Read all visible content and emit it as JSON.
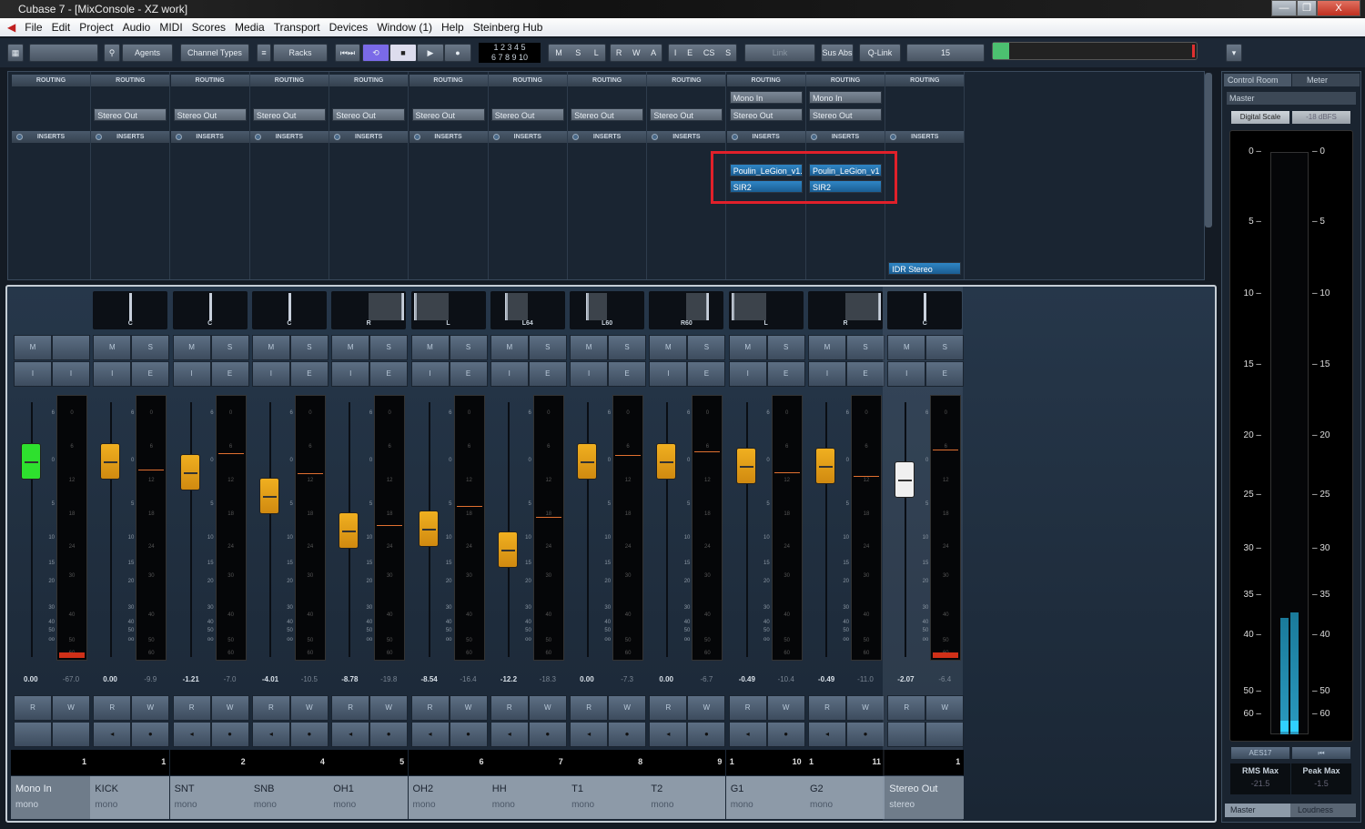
{
  "window": {
    "title": "Cubase 7 - [MixConsole - XZ work]",
    "min": "—",
    "max": "❐",
    "close": "X"
  },
  "menu": [
    "File",
    "Edit",
    "Project",
    "Audio",
    "MIDI",
    "Scores",
    "Media",
    "Transport",
    "Devices",
    "Window (1)",
    "Help",
    "Steinberg Hub"
  ],
  "toolbar": {
    "agents": "Agents",
    "channel_types": "Channel Types",
    "racks": "Racks",
    "numbers_top": "1 2 3 4 5",
    "numbers_bottom": "6 7 8 9 10",
    "m": "M",
    "s": "S",
    "l": "L",
    "r": "R",
    "w": "W",
    "a": "A",
    "i": "I",
    "e": "E",
    "cs": "CS",
    "s2": "S",
    "link": "Link",
    "sus_abs": "Sus Abs",
    "qlink": "Q-Link",
    "zoom_value": "15",
    "level": 0.08
  },
  "rack": {
    "routing_label": "ROUTING",
    "inserts_label": "INSERTS"
  },
  "channels": [
    {
      "name": "Mono In",
      "type": "mono",
      "pan": "",
      "num": "1",
      "prefix": "",
      "fader": "0.00",
      "peak": "-67.0",
      "db": 0,
      "pk": -67,
      "input": "",
      "output": "",
      "inserts": [],
      "ms": [
        "M",
        ""
      ],
      "ie": [
        "I",
        "I"
      ],
      "row2": [
        "",
        ""
      ],
      "color": "#2ee02e",
      "clip": true,
      "first": true
    },
    {
      "name": "KICK",
      "type": "mono",
      "pan": "C",
      "num": "1",
      "prefix": "",
      "fader": "0.00",
      "peak": "-9.9",
      "db": 0,
      "pk": -9.9,
      "input": "",
      "output": "Stereo Out",
      "inserts": [],
      "ms": [
        "M",
        "S"
      ],
      "ie": [
        "I",
        "E"
      ],
      "row2": [
        "◂",
        "●"
      ]
    },
    {
      "name": "SNT",
      "type": "mono",
      "pan": "C",
      "num": "2",
      "prefix": "",
      "fader": "-1.21",
      "peak": "-7.0",
      "db": -1.21,
      "pk": -7,
      "input": "",
      "output": "Stereo Out",
      "inserts": [],
      "ms": [
        "M",
        "S"
      ],
      "ie": [
        "I",
        "E"
      ],
      "row2": [
        "◂",
        "●"
      ]
    },
    {
      "name": "SNB",
      "type": "mono",
      "pan": "C",
      "num": "4",
      "prefix": "",
      "fader": "-4.01",
      "peak": "-10.5",
      "db": -4.01,
      "pk": -10.5,
      "input": "",
      "output": "Stereo Out",
      "inserts": [],
      "ms": [
        "M",
        "S"
      ],
      "ie": [
        "I",
        "E"
      ],
      "row2": [
        "◂",
        "●"
      ]
    },
    {
      "name": "OH1",
      "type": "mono",
      "pan": "R",
      "num": "5",
      "prefix": "",
      "fader": "-8.78",
      "peak": "-19.8",
      "db": -8.78,
      "pk": -19.8,
      "input": "",
      "output": "Stereo Out",
      "inserts": [],
      "ms": [
        "M",
        "S"
      ],
      "ie": [
        "I",
        "E"
      ],
      "row2": [
        "◂",
        "●"
      ]
    },
    {
      "name": "OH2",
      "type": "mono",
      "pan": "L",
      "num": "6",
      "prefix": "",
      "fader": "-8.54",
      "peak": "-16.4",
      "db": -8.54,
      "pk": -16.4,
      "input": "",
      "output": "Stereo Out",
      "inserts": [],
      "ms": [
        "M",
        "S"
      ],
      "ie": [
        "I",
        "E"
      ],
      "row2": [
        "◂",
        "●"
      ]
    },
    {
      "name": "HH",
      "type": "mono",
      "pan": "L64",
      "num": "7",
      "prefix": "",
      "fader": "-12.2",
      "peak": "-18.3",
      "db": -12.2,
      "pk": -18.3,
      "input": "",
      "output": "Stereo Out",
      "inserts": [],
      "ms": [
        "M",
        "S"
      ],
      "ie": [
        "I",
        "E"
      ],
      "row2": [
        "◂",
        "●"
      ]
    },
    {
      "name": "T1",
      "type": "mono",
      "pan": "L60",
      "num": "8",
      "prefix": "",
      "fader": "0.00",
      "peak": "-7.3",
      "db": 0,
      "pk": -7.3,
      "input": "",
      "output": "Stereo Out",
      "inserts": [],
      "ms": [
        "M",
        "S"
      ],
      "ie": [
        "I",
        "E"
      ],
      "row2": [
        "◂",
        "●"
      ]
    },
    {
      "name": "T2",
      "type": "mono",
      "pan": "R60",
      "num": "9",
      "prefix": "",
      "fader": "0.00",
      "peak": "-6.7",
      "db": 0,
      "pk": -6.7,
      "input": "",
      "output": "Stereo Out",
      "inserts": [],
      "ms": [
        "M",
        "S"
      ],
      "ie": [
        "I",
        "E"
      ],
      "row2": [
        "◂",
        "●"
      ]
    },
    {
      "name": "G1",
      "type": "mono",
      "pan": "L",
      "num": "10",
      "prefix": "1",
      "fader": "-0.49",
      "peak": "-10.4",
      "db": -0.49,
      "pk": -10.4,
      "input": "Mono In",
      "output": "Stereo Out",
      "inserts": [
        "Poulin_LeGion_v1.",
        "SIR2"
      ],
      "ms": [
        "M",
        "S"
      ],
      "ie": [
        "I",
        "E"
      ],
      "row2": [
        "◂",
        "●"
      ]
    },
    {
      "name": "G2",
      "type": "mono",
      "pan": "R",
      "num": "11",
      "prefix": "1",
      "fader": "-0.49",
      "peak": "-11.0",
      "db": -0.49,
      "pk": -11,
      "input": "Mono In",
      "output": "Stereo Out",
      "inserts": [
        "Poulin_LeGion_v1",
        "SIR2"
      ],
      "ms": [
        "M",
        "S"
      ],
      "ie": [
        "I",
        "E"
      ],
      "row2": [
        "◂",
        "●"
      ]
    },
    {
      "name": "Stereo Out",
      "type": "stereo",
      "pan": "C",
      "num": "1",
      "prefix": "",
      "fader": "-2.07",
      "peak": "-6.4",
      "db": -2.07,
      "pk": -6.4,
      "input": "",
      "output": "",
      "inserts": [],
      "bottom_insert": "IDR Stereo",
      "ms": [
        "M",
        "S"
      ],
      "ie": [
        "I",
        "E"
      ],
      "row2": [
        "",
        ""
      ],
      "color": "#f0f0f0",
      "clip": true,
      "stereo": true
    }
  ],
  "fader_scale": [
    "6",
    "0",
    "5",
    "10",
    "15",
    "20",
    "30",
    "40",
    "50",
    "oo"
  ],
  "meter_scale": [
    "0",
    "6",
    "12",
    "18",
    "24",
    "30",
    "40",
    "50",
    "60"
  ],
  "control_room": {
    "tab1": "Control Room",
    "tab2": "Meter",
    "section": "Master",
    "digital_scale": "Digital Scale",
    "dbfs": "-18 dBFS",
    "scale": [
      "0",
      "5",
      "10",
      "15",
      "20",
      "25",
      "30",
      "35",
      "40",
      "50",
      "60"
    ],
    "aes": "AES17",
    "reset": "⏮",
    "rms_label": "RMS Max",
    "rms_value": "-21.5",
    "peak_label": "Peak Max",
    "peak_value": "-1.5",
    "bottom_tab1": "Master",
    "bottom_tab2": "Loudness",
    "levels": [
      0.2,
      0.21
    ]
  },
  "colors": {
    "fader": "#f0b020",
    "highlight": "#e0202a"
  }
}
